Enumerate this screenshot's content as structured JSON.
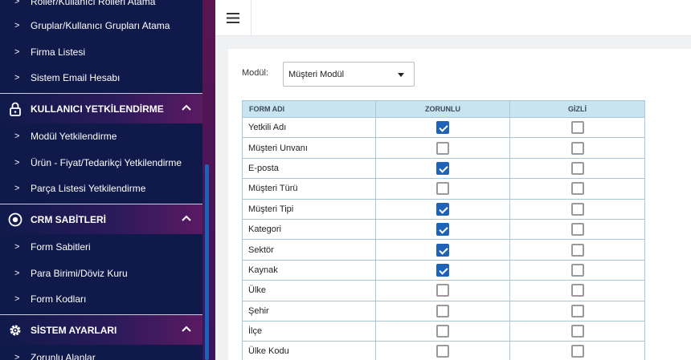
{
  "sidebar": {
    "items_top": [
      {
        "label": "Roller/Kullanıcı Rolleri Atama"
      },
      {
        "label": "Gruplar/Kullanıcı Grupları Atama"
      },
      {
        "label": "Firma Listesi"
      },
      {
        "label": "Sistem Email Hesabı"
      }
    ],
    "section_user": {
      "title": "KULLANICI YETKİLENDİRME",
      "icon": "lock-icon",
      "items": [
        {
          "label": "Modül Yetkilendirme"
        },
        {
          "label": "Ürün - Fiyat/Tedarikçi Yetkilendirme"
        },
        {
          "label": "Parça Listesi Yetkilendirme"
        }
      ]
    },
    "section_crm": {
      "title": "CRM SABİTLERİ",
      "icon": "target-icon",
      "items": [
        {
          "label": "Form Sabitleri"
        },
        {
          "label": "Para Birimi/Döviz Kuru"
        },
        {
          "label": "Form Kodları"
        }
      ]
    },
    "section_system": {
      "title": "SİSTEM AYARLARI",
      "icon": "gear-icon",
      "items": [
        {
          "label": "Zorunlu Alanlar"
        }
      ]
    }
  },
  "topbar": {
    "menu_icon": "hamburger-icon"
  },
  "filter": {
    "label": "Modül:",
    "selected": "Müşteri Modül"
  },
  "table": {
    "headers": {
      "form_adi": "FORM ADI",
      "zorunlu": "ZORUNLU",
      "gizli": "GİZLİ"
    },
    "rows": [
      {
        "name": "Yetkili Adı",
        "zorunlu": true,
        "gizli": false
      },
      {
        "name": "Müşteri Unvanı",
        "zorunlu": false,
        "gizli": false
      },
      {
        "name": "E-posta",
        "zorunlu": true,
        "gizli": false
      },
      {
        "name": "Müşteri Türü",
        "zorunlu": false,
        "gizli": false
      },
      {
        "name": "Müşteri Tipi",
        "zorunlu": true,
        "gizli": false
      },
      {
        "name": "Kategori",
        "zorunlu": true,
        "gizli": false
      },
      {
        "name": "Sektör",
        "zorunlu": true,
        "gizli": false
      },
      {
        "name": "Kaynak",
        "zorunlu": true,
        "gizli": false
      },
      {
        "name": "Ülke",
        "zorunlu": false,
        "gizli": false
      },
      {
        "name": "Şehir",
        "zorunlu": false,
        "gizli": false
      },
      {
        "name": "İlçe",
        "zorunlu": false,
        "gizli": false
      },
      {
        "name": "Ülke Kodu",
        "zorunlu": false,
        "gizli": false
      }
    ]
  },
  "colors": {
    "sidebar_bg": "#0f1a4a",
    "accent": "#1e63b8",
    "header_bg": "#c8e3f2"
  }
}
